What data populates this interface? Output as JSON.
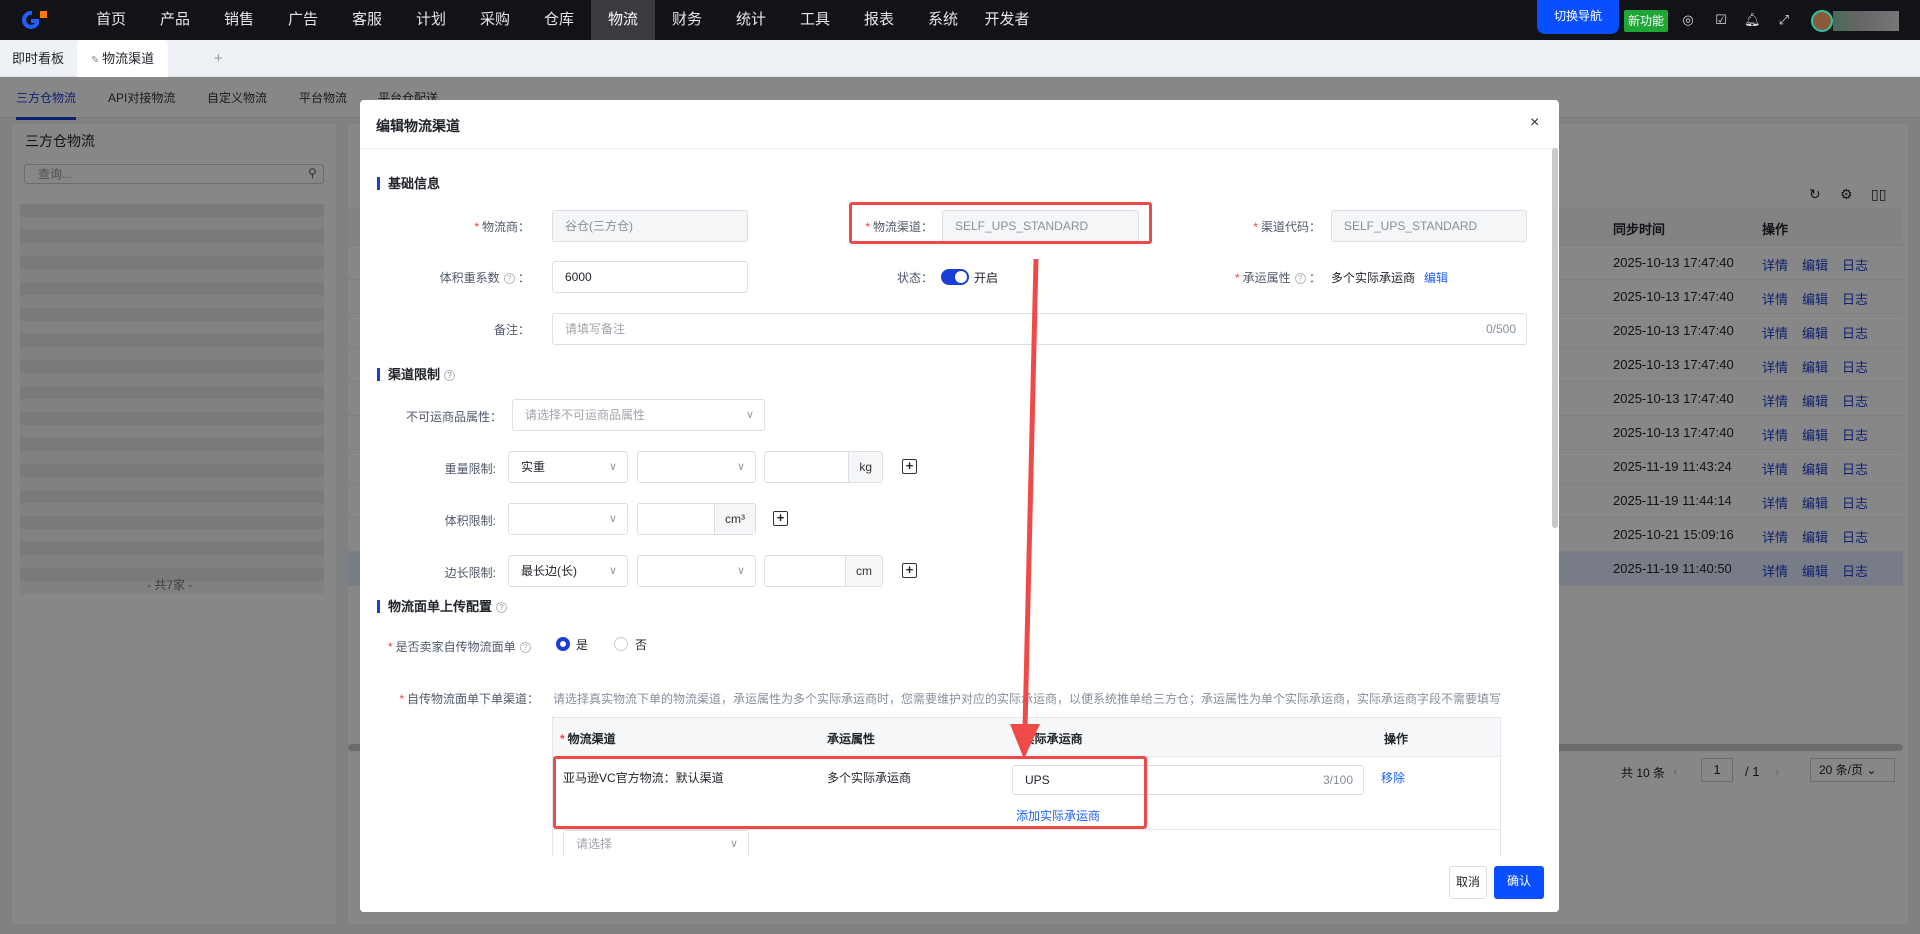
{
  "topbar": {
    "nav": [
      "首页",
      "产品",
      "销售",
      "广告",
      "客服",
      "计划",
      "采购",
      "仓库",
      "物流",
      "财务",
      "统计",
      "工具",
      "报表",
      "系统",
      "开发者"
    ],
    "active_nav": "物流",
    "switch_nav": "切换导航",
    "new_feature": "新功能"
  },
  "tabs": {
    "home": "即时看板",
    "active": "物流渠道",
    "add": "+"
  },
  "subtabs": [
    "三方仓物流",
    "API对接物流",
    "自定义物流",
    "平台物流",
    "平台仓配送"
  ],
  "left_panel": {
    "title": "三方仓物流",
    "search_placeholder": "查询...",
    "footer": "- 共7家 -"
  },
  "table": {
    "headers": {
      "sync_time": "同步时间",
      "ops": "操作"
    },
    "rows": [
      "2025-10-13 17:47:40",
      "2025-10-13 17:47:40",
      "2025-10-13 17:47:40",
      "2025-10-13 17:47:40",
      "2025-10-13 17:47:40",
      "2025-10-13 17:47:40",
      "2025-11-19 11:43:24",
      "2025-11-19 11:44:14",
      "2025-10-21 15:09:16",
      "2025-11-19 11:40:50"
    ],
    "op_detail": "详情",
    "op_edit": "编辑",
    "op_log": "日志"
  },
  "pagination": {
    "total": "共 10 条",
    "page": "1",
    "pages": "/ 1",
    "page_size": "20 条/页"
  },
  "modal": {
    "title": "编辑物流渠道",
    "basic": {
      "section": "基础信息",
      "carrier_label": "物流商：",
      "carrier_value": "谷仓(三方仓)",
      "channel_label": "物流渠道：",
      "channel_value": "SELF_UPS_STANDARD",
      "code_label": "渠道代码：",
      "code_value": "SELF_UPS_STANDARD",
      "vol_label": "体积重系数",
      "vol_value": "6000",
      "status_label": "状态：",
      "status_value": "开启",
      "status_on": true,
      "ship_attr_label": "承运属性",
      "ship_attr_value": "多个实际承运商",
      "ship_attr_edit": "编辑",
      "remark_label": "备注：",
      "remark_placeholder": "请填写备注",
      "remark_count": "0/500"
    },
    "limits": {
      "section": "渠道限制",
      "goods_label": "不可运商品属性：",
      "goods_placeholder": "请选择不可运商品属性",
      "weight_label": "重量限制:",
      "weight_type": "实重",
      "weight_unit": "kg",
      "volume_label": "体积限制:",
      "volume_unit": "cm³",
      "side_label": "边长限制:",
      "side_type": "最长边(长)",
      "side_unit": "cm"
    },
    "upload": {
      "section": "物流面单上传配置",
      "self_label": "是否卖家自传物流面单",
      "yes": "是",
      "no": "否",
      "selected": "是",
      "channel_label": "自传物流面单下单渠道：",
      "hint": "请选择真实物流下单的物流渠道，承运属性为多个实际承运商时，您需要维护对应的实际承运商，以便系统推单给三方仓；承运属性为单个实际承运商，实际承运商字段不需要填写",
      "table": {
        "headers": [
          "物流渠道",
          "承运属性",
          "实际承运商",
          "操作"
        ],
        "row": {
          "channel": "亚马逊VC官方物流：默认渠道",
          "attr": "多个实际承运商",
          "carrier": "UPS",
          "count": "3/100",
          "add": "添加实际承运商",
          "remove": "移除"
        },
        "select_placeholder": "请选择"
      }
    },
    "cancel": "取消",
    "confirm": "确认"
  },
  "colors": {
    "accent": "#1b5fff",
    "annotation": "#f04a48"
  }
}
